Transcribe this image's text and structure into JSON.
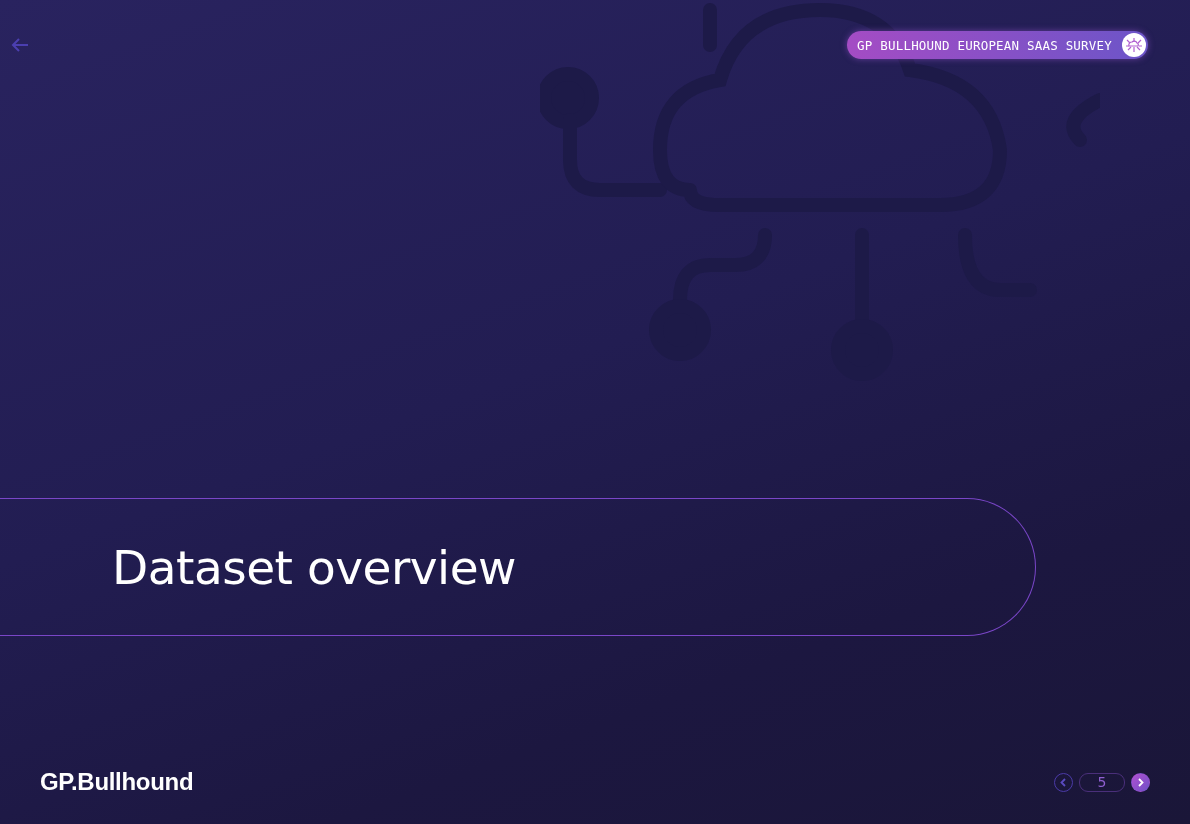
{
  "header": {
    "badge": "GP BULLHOUND EUROPEAN SAAS SURVEY"
  },
  "section": {
    "title": "Dataset overview"
  },
  "footer": {
    "logo": "GP.Bullhound",
    "page": "5"
  }
}
